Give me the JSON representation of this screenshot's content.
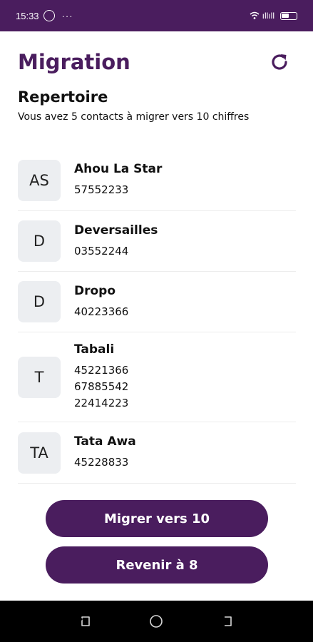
{
  "status": {
    "time": "15:33",
    "dots": "···",
    "signal": "ıllıll"
  },
  "header": {
    "title": "Migration"
  },
  "section": {
    "title": "Repertoire",
    "subtitle": "Vous avez 5 contacts à migrer vers 10 chiffres"
  },
  "contacts": [
    {
      "initials": "AS",
      "name": "Ahou La Star",
      "phones": [
        "57552233"
      ]
    },
    {
      "initials": "D",
      "name": "Deversailles",
      "phones": [
        "03552244"
      ]
    },
    {
      "initials": "D",
      "name": "Dropo",
      "phones": [
        "40223366"
      ]
    },
    {
      "initials": "T",
      "name": "Tabali",
      "phones": [
        "45221366",
        "67885542",
        "22414223"
      ]
    },
    {
      "initials": "TA",
      "name": "Tata Awa",
      "phones": [
        "45228833"
      ]
    }
  ],
  "actions": {
    "migrate_label": "Migrer vers 10",
    "revert_label": "Revenir à 8"
  },
  "colors": {
    "primary": "#4a1d5e",
    "avatar_bg": "#eceef1"
  },
  "icons": {
    "refresh": "refresh-icon",
    "whatsapp": "whatsapp-icon",
    "wifi": "wifi-icon",
    "battery": "battery-icon",
    "recent": "recent-apps-icon",
    "home": "home-icon",
    "back": "back-icon"
  }
}
